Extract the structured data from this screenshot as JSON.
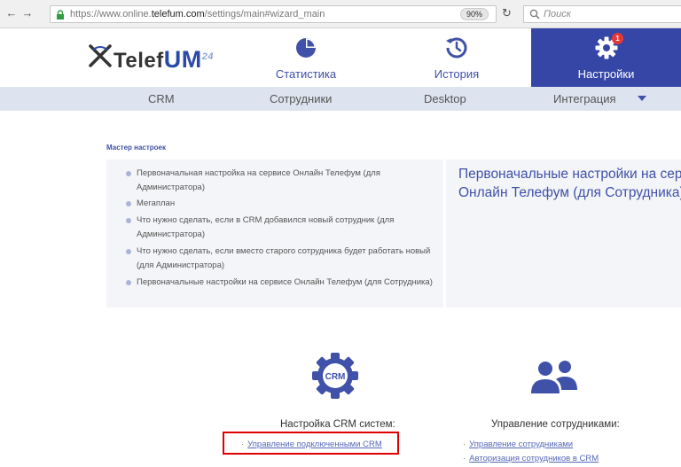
{
  "browser": {
    "url_prefix": "https://www.online.",
    "url_domain": "telefum.com",
    "url_suffix": "/settings/main#wizard_main",
    "zoom": "90%",
    "search_placeholder": "Поиск"
  },
  "header": {
    "logo_text_prefix": "Telef",
    "logo_text_um": "UM",
    "logo_text_sup": "24",
    "tabs": [
      {
        "label": "Статистика",
        "icon": "pie-chart-icon"
      },
      {
        "label": "История",
        "icon": "history-icon"
      },
      {
        "label": "Настройки",
        "icon": "gear-icon",
        "badge": "1",
        "active": true
      }
    ]
  },
  "subnav": {
    "items": [
      "CRM",
      "Сотрудники",
      "Desktop",
      "Интеграция"
    ]
  },
  "wizard": {
    "title": "Мастер настроек",
    "items": [
      "Первоначальная настройка на сервисе Онлайн Телефум (для Администратора)",
      "Мегаплан",
      "Что нужно сделать, если в CRM добавился новый сотрудник (для Администратора)",
      "Что нужно сделать, если вместо старого сотрудника будет работать новый (для Администратора)",
      "Первоначальные настройки на сервисе Онлайн Телефум (для Сотрудника)"
    ],
    "panel_title": "Первоначальные настройки на сервисе Онлайн Телефум (для Сотрудника)"
  },
  "sections": {
    "crm": {
      "title": "Настройка CRM систем:",
      "icon_label": "CRM",
      "links": [
        "Управление подключенными CRM"
      ]
    },
    "staff": {
      "title": "Управление сотрудниками:",
      "links": [
        "Управление сотрудниками",
        "Авторизация сотрудников в CRM"
      ]
    }
  },
  "colors": {
    "brand_blue": "#3546a6",
    "subnav_bg": "#dde4f0",
    "highlight_red": "#e00000"
  }
}
